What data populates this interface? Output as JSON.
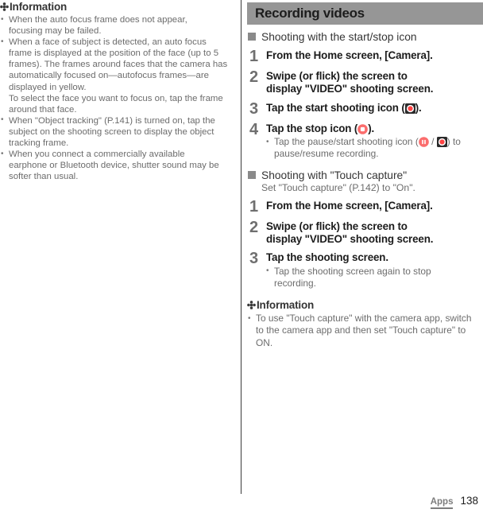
{
  "page": {
    "footer_section": "Apps",
    "page_number": "138"
  },
  "colors": {
    "chapter_bar_bg": "#969696",
    "body_text": "#6c6c6c",
    "heading_text": "#353535",
    "step_number": "#6f6f6f",
    "record_red": "#ff4444",
    "stop_icon_bg": "#fb6d6d",
    "pause_icon_bg": "#fb6d6d",
    "divider": "#3b3b3b",
    "square_bullet": "#8a8a8a"
  },
  "left_column": {
    "information_heading": "Information",
    "bullets": [
      {
        "lines": [
          "When the auto focus frame does not appear,",
          "focusing may be failed."
        ]
      },
      {
        "lines": [
          "When a face of subject is detected, an auto focus",
          "frame is displayed at the position of the face (up to 5",
          "frames). The frames around faces that the camera has",
          "automatically focused on—autofocus frames—are",
          "displayed in yellow.",
          "To select the face you want to focus on, tap the frame",
          "around that face."
        ]
      },
      {
        "lines": [
          "When \"Object tracking\" (P.141) is turned on, tap the",
          "subject on the shooting screen to display the object",
          "tracking frame."
        ]
      },
      {
        "lines": [
          "When you connect a commercially available",
          "earphone or Bluetooth device, shutter sound may be",
          "softer than usual."
        ]
      }
    ]
  },
  "right_column": {
    "chapter_title": "Recording videos",
    "section_1": {
      "heading": "Shooting with the start/stop icon",
      "steps": [
        {
          "number": "1",
          "title_lines": [
            "From the Home screen, [Camera]."
          ]
        },
        {
          "number": "2",
          "title_lines": [
            "Swipe (or flick) the screen to",
            "display \"VIDEO\" shooting screen."
          ]
        },
        {
          "number": "3",
          "title_prefix": "Tap the start shooting icon (",
          "title_icon": "record-start-icon",
          "title_suffix": ")."
        },
        {
          "number": "4",
          "title_prefix": "Tap the stop icon (",
          "title_icon": "record-stop-icon",
          "title_suffix": ").",
          "sub_bullet": {
            "part1": "Tap the pause/start shooting icon (",
            "icon1": "record-pause-icon",
            "part2": " / ",
            "icon2": "record-start-icon",
            "part3": ") to pause/resume recording."
          }
        }
      ]
    },
    "section_2": {
      "heading": "Shooting with \"Touch capture\"",
      "subtext": "Set \"Touch capture\" (P.142) to \"On\".",
      "steps": [
        {
          "number": "1",
          "title_lines": [
            "From the Home screen, [Camera]."
          ]
        },
        {
          "number": "2",
          "title_lines": [
            "Swipe (or flick) the screen to",
            "display \"VIDEO\" shooting screen."
          ]
        },
        {
          "number": "3",
          "title_lines": [
            "Tap the shooting screen."
          ],
          "sub_bullet_lines": [
            "Tap the shooting screen again to stop",
            "recording."
          ]
        }
      ]
    },
    "information": {
      "heading": "Information",
      "bullets": [
        {
          "lines": [
            "To use \"Touch capture\" with the camera app, switch",
            "to the camera app and then set \"Touch capture\" to",
            "ON."
          ]
        }
      ]
    }
  }
}
